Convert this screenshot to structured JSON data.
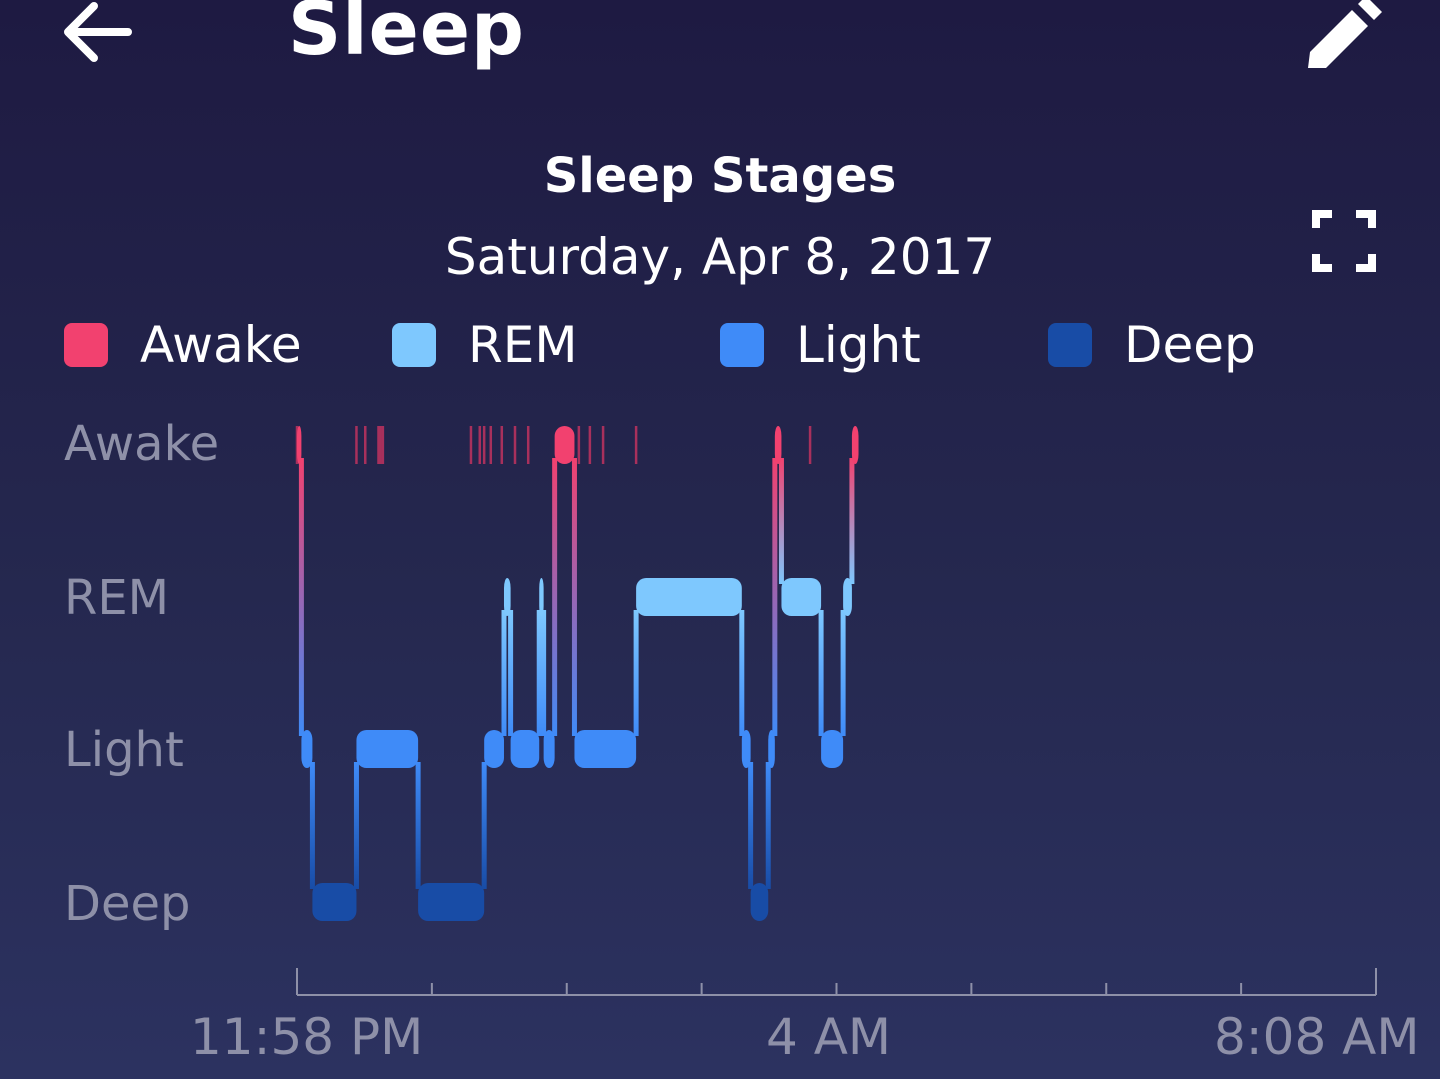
{
  "header": {
    "title": "Sleep",
    "back_icon": "arrow-left-icon",
    "edit_icon": "pencil-icon"
  },
  "chart": {
    "title": "Sleep Stages",
    "subtitle": "Saturday, Apr 8, 2017",
    "expand_icon": "fullscreen-icon"
  },
  "legend": [
    {
      "label": "Awake",
      "color": "#f2416f"
    },
    {
      "label": "REM",
      "color": "#7ec8fe"
    },
    {
      "label": "Light",
      "color": "#3f8bf8"
    },
    {
      "label": "Deep",
      "color": "#184ca6"
    }
  ],
  "chart_data": {
    "type": "area",
    "title": "Sleep Stages",
    "subtitle": "Saturday, Apr 8, 2017",
    "y_categories": [
      "Awake",
      "REM",
      "Light",
      "Deep"
    ],
    "x_tick_labels": [
      "11:58 PM",
      "4 AM",
      "8:08 AM"
    ],
    "x_range": [
      "11:58 PM",
      "8:08 AM"
    ],
    "grid": false,
    "legend_position": "top",
    "segments": [
      {
        "start": "11:58 PM",
        "end": "12:00 AM",
        "stage": "Awake"
      },
      {
        "start": "12:00 AM",
        "end": "12:05 AM",
        "stage": "Light"
      },
      {
        "start": "12:05 AM",
        "end": "12:25 AM",
        "stage": "Deep"
      },
      {
        "start": "12:25 AM",
        "end": "12:53 AM",
        "stage": "Light"
      },
      {
        "start": "12:53 AM",
        "end": "1:23 AM",
        "stage": "Deep"
      },
      {
        "start": "1:23 AM",
        "end": "1:32 AM",
        "stage": "Light"
      },
      {
        "start": "1:32 AM",
        "end": "1:35 AM",
        "stage": "REM"
      },
      {
        "start": "1:35 AM",
        "end": "1:48 AM",
        "stage": "Light"
      },
      {
        "start": "1:48 AM",
        "end": "1:50 AM",
        "stage": "REM"
      },
      {
        "start": "1:50 AM",
        "end": "1:55 AM",
        "stage": "Light"
      },
      {
        "start": "1:55 AM",
        "end": "2:04 AM",
        "stage": "Awake"
      },
      {
        "start": "2:04 AM",
        "end": "2:32 AM",
        "stage": "Light"
      },
      {
        "start": "2:32 AM",
        "end": "3:20 AM",
        "stage": "REM"
      },
      {
        "start": "3:20 AM",
        "end": "3:24 AM",
        "stage": "Light"
      },
      {
        "start": "3:24 AM",
        "end": "3:32 AM",
        "stage": "Deep"
      },
      {
        "start": "3:32 AM",
        "end": "3:35 AM",
        "stage": "Light"
      },
      {
        "start": "3:35 AM",
        "end": "3:38 AM",
        "stage": "Awake"
      },
      {
        "start": "3:38 AM",
        "end": "3:56 AM",
        "stage": "REM"
      },
      {
        "start": "3:56 AM",
        "end": "4:06 AM",
        "stage": "Light"
      },
      {
        "start": "4:06 AM",
        "end": "4:10 AM",
        "stage": "REM"
      },
      {
        "start": "4:10 AM",
        "end": "4:13 AM",
        "stage": "Awake"
      }
    ],
    "brief_awakenings": [
      "11:58 PM",
      "12:25 AM",
      "12:29 AM",
      "12:35 AM",
      "12:36 AM",
      "12:37 AM",
      "1:17 AM",
      "1:21 AM",
      "1:23 AM",
      "1:26 AM",
      "1:31 AM",
      "1:37 AM",
      "1:43 AM",
      "2:06 AM",
      "2:11 AM",
      "2:17 AM",
      "2:32 AM",
      "3:51 AM"
    ]
  }
}
